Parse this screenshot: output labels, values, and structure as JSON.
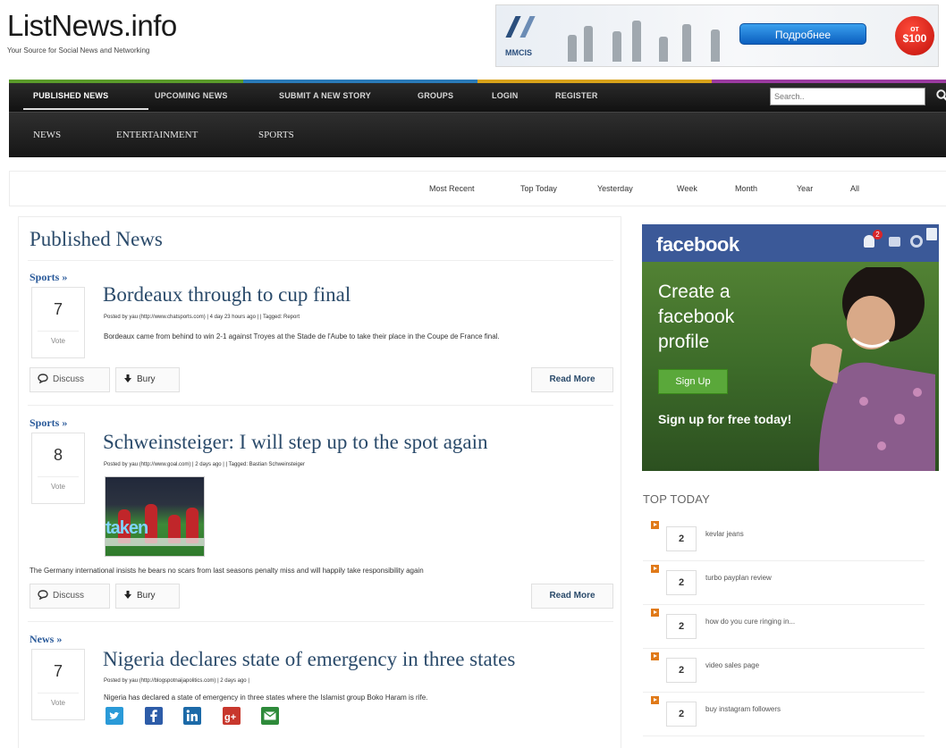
{
  "header": {
    "site_title": "ListNews.info",
    "tagline": "Your Source for Social News and Networking",
    "ad_banner": {
      "brand": "MMCIS",
      "button_label": "Подробнее",
      "badge_top": "от",
      "badge_amount": "$100"
    }
  },
  "nav_primary": {
    "items": [
      "PUBLISHED NEWS",
      "UPCOMING NEWS",
      "SUBMIT A NEW STORY",
      "GROUPS",
      "LOGIN",
      "REGISTER"
    ],
    "active": "PUBLISHED NEWS",
    "search_placeholder": "Search.."
  },
  "nav_secondary": {
    "items": [
      "NEWS",
      "ENTERTAINMENT",
      "SPORTS"
    ]
  },
  "filters": [
    "Most Recent",
    "Top Today",
    "Yesterday",
    "Week",
    "Month",
    "Year",
    "All"
  ],
  "main": {
    "title": "Published News",
    "stories": [
      {
        "category": "Sports »",
        "votes": "7",
        "vote_label": "Vote",
        "title": "Bordeaux through to cup final",
        "meta": "Posted by yau (http://www.chatsports.com) | 4 day 23 hours ago | | Tagged: Report",
        "description": "Bordeaux came from behind to win 2-1 against Troyes at the Stade de l'Aube to take their place in the Coupe de France final.",
        "actions": {
          "discuss": "Discuss",
          "bury": "Bury",
          "read_more": "Read More"
        }
      },
      {
        "category": "Sports »",
        "votes": "8",
        "vote_label": "Vote",
        "title": "Schweinsteiger: I will step up to the spot again",
        "meta": "Posted by yau (http://www.goal.com) | 2 days ago | | Tagged: Bastian Schweinsteiger",
        "thumbnail_text": "taken",
        "description": "The Germany international insists he bears no scars from last seasons penalty miss and will happily take responsibility again",
        "actions": {
          "discuss": "Discuss",
          "bury": "Bury",
          "read_more": "Read More"
        }
      },
      {
        "category": "News »",
        "votes": "7",
        "vote_label": "Vote",
        "title": "Nigeria declares state of emergency in three states",
        "meta": "Posted by yau (http://blogspotnaijapolitics.com) | 2 days ago |",
        "description": "Nigeria has declared a state of emergency in three states where the Islamist group Boko Haram is rife.",
        "share_icons": [
          "twitter-icon",
          "facebook-icon",
          "linkedin-icon",
          "google-plus-icon",
          "email-icon"
        ]
      }
    ]
  },
  "sidebar": {
    "facebook_ad": {
      "brand": "facebook",
      "headline": [
        "Create a",
        "facebook",
        "profile"
      ],
      "button": "Sign Up",
      "subline": "Sign up for free today!",
      "notification_count": "2"
    },
    "top_today": {
      "title": "TOP TODAY",
      "items": [
        {
          "count": "2",
          "label": "kevlar jeans"
        },
        {
          "count": "2",
          "label": "turbo payplan review"
        },
        {
          "count": "2",
          "label": "how do you cure ringing in..."
        },
        {
          "count": "2",
          "label": "video sales page"
        },
        {
          "count": "2",
          "label": "buy instagram followers"
        }
      ]
    }
  },
  "colors": {
    "nav_bg": "#1a1a1a",
    "title_blue": "#2a4a6a",
    "category_blue": "#2a5a9a",
    "facebook_blue": "#3b5998",
    "bullet_orange": "#e07a1a"
  }
}
